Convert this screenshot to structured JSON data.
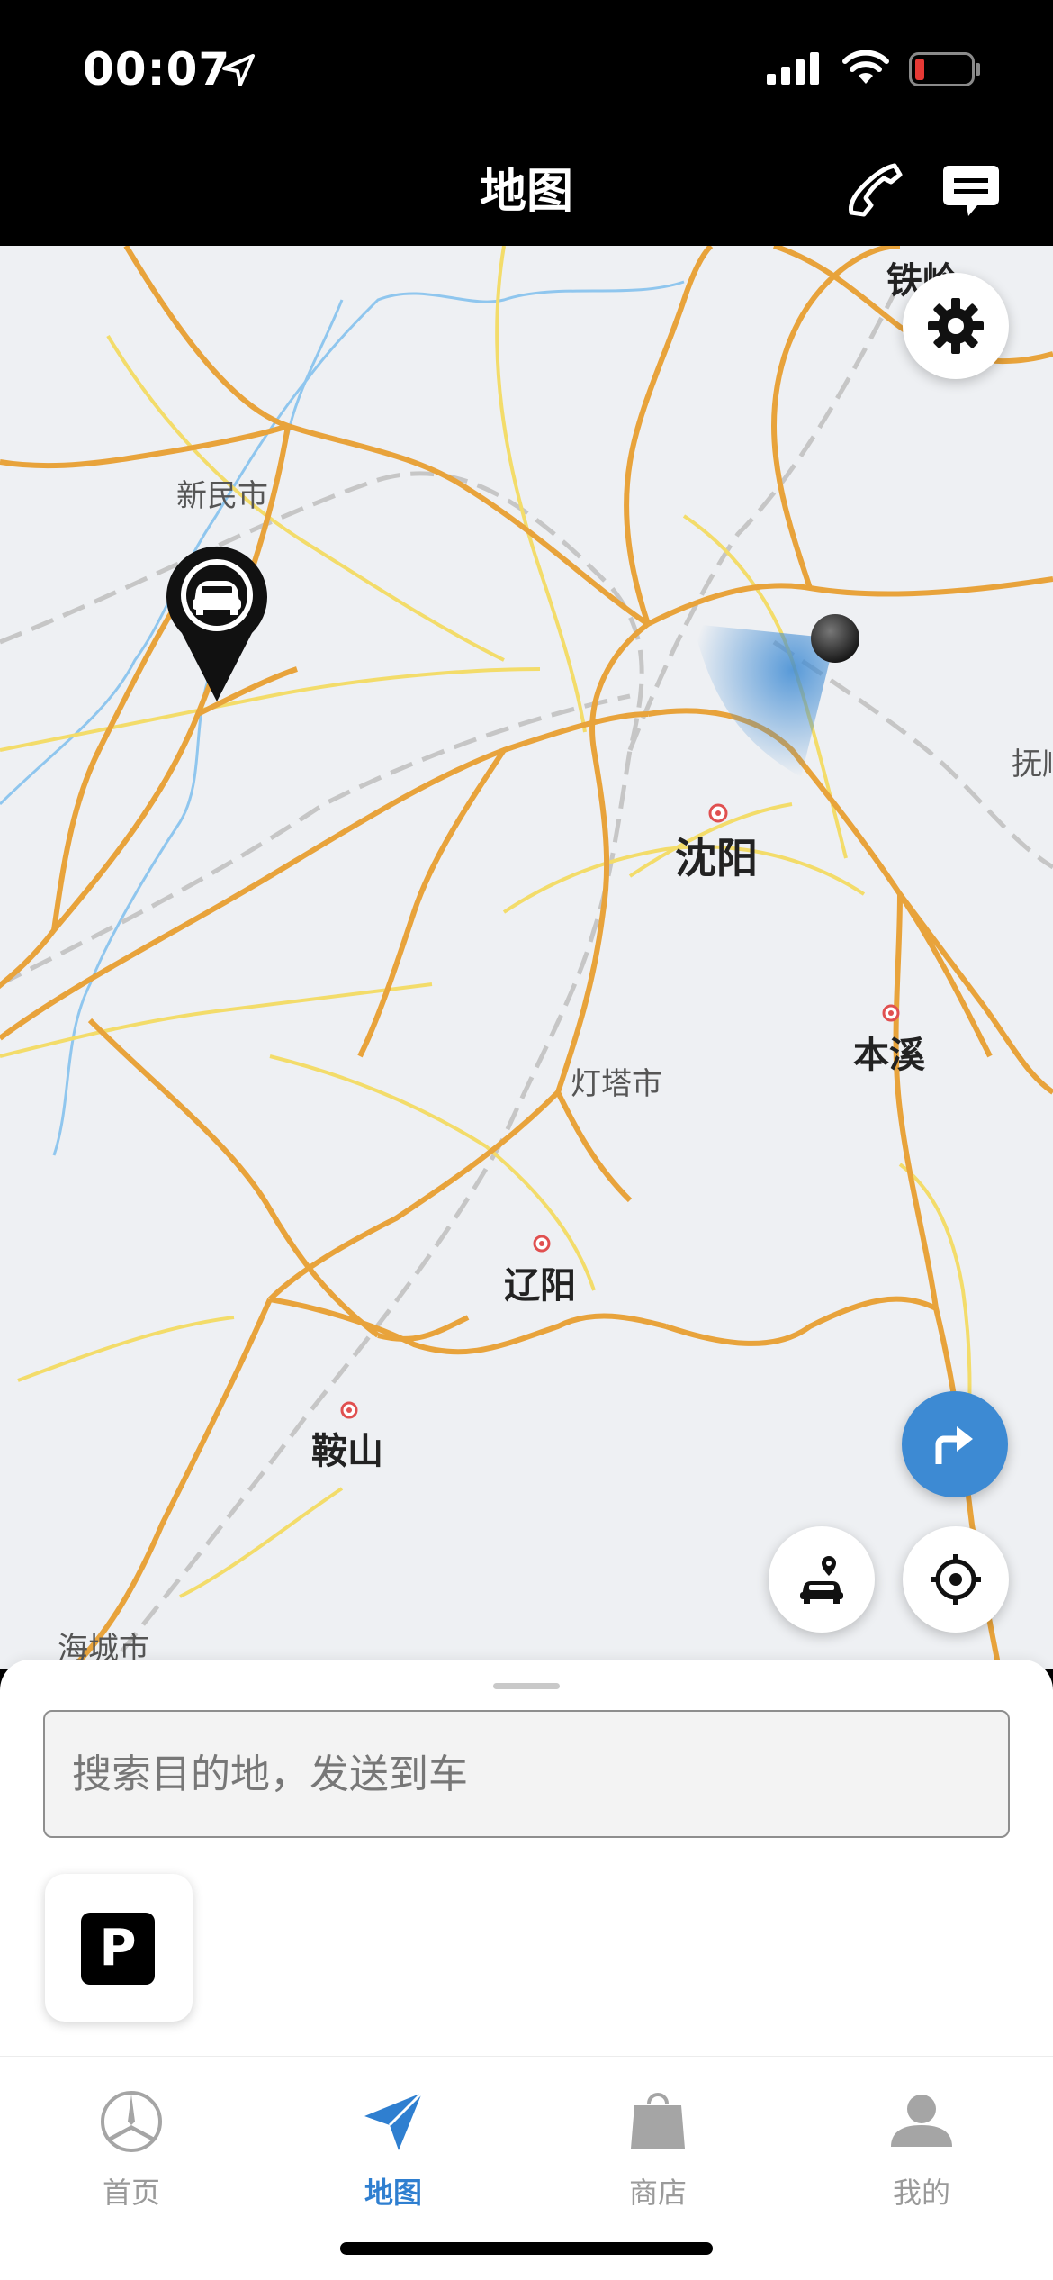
{
  "status_bar": {
    "time": "00:07",
    "icons": [
      "location-arrow-icon",
      "cellular-signal-icon",
      "wifi-icon",
      "battery-low-icon"
    ]
  },
  "nav_bar": {
    "title": "地图",
    "actions": [
      {
        "name": "phone-icon"
      },
      {
        "name": "chat-icon"
      }
    ]
  },
  "map": {
    "cities": [
      {
        "name": "铁岭",
        "tier": "mid"
      },
      {
        "name": "新民市",
        "tier": "small"
      },
      {
        "name": "抚顺",
        "tier": "small"
      },
      {
        "name": "沈阳",
        "tier": "major"
      },
      {
        "name": "本溪",
        "tier": "mid"
      },
      {
        "name": "灯塔市",
        "tier": "small"
      },
      {
        "name": "辽阳",
        "tier": "mid"
      },
      {
        "name": "鞍山",
        "tier": "mid"
      },
      {
        "name": "海城市",
        "tier": "small"
      }
    ],
    "controls": {
      "settings": "gear-icon",
      "navigate": "turn-right-icon",
      "car_location": "car-location-icon",
      "my_location": "crosshair-icon"
    },
    "colors": {
      "background": "#eef0f3",
      "highway": "#e8a33b",
      "road": "#f3dc6a",
      "rail": "#c9c9c9",
      "water": "#8fc6ee",
      "accent": "#3d8ad3"
    }
  },
  "sheet": {
    "search_placeholder": "搜索目的地，发送到车",
    "parking_label": "P"
  },
  "tab_bar": {
    "tabs": [
      {
        "label": "首页",
        "icon": "mercedes-star-icon",
        "active": false
      },
      {
        "label": "地图",
        "icon": "navigation-arrow-icon",
        "active": true
      },
      {
        "label": "商店",
        "icon": "shopping-bag-icon",
        "active": false
      },
      {
        "label": "我的",
        "icon": "person-icon",
        "active": false
      }
    ]
  }
}
